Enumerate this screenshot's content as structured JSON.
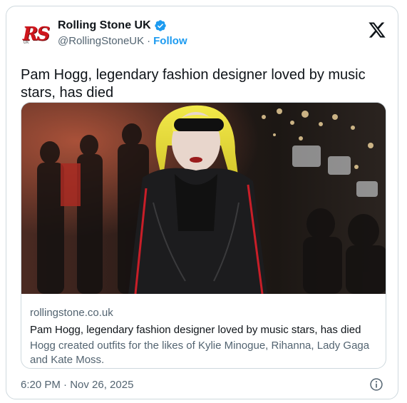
{
  "account": {
    "logo_text": "RS",
    "logo_sub": "UK",
    "display_name": "Rolling Stone UK",
    "handle": "@RollingStoneUK",
    "separator": "·",
    "follow_label": "Follow"
  },
  "tweet": {
    "text": "Pam Hogg, legendary fashion designer loved by music stars, has died"
  },
  "link_card": {
    "domain": "rollingstone.co.uk",
    "title": "Pam Hogg, legendary fashion designer loved by music stars, has died",
    "description": "Hogg created outfits for the likes of Kylie Minogue, Rihanna, Lady Gaga and Kate Moss."
  },
  "footer": {
    "timestamp": "6:20 PM · Nov 26, 2025"
  },
  "icons": {
    "verified": "verified-badge-icon",
    "x_logo": "x-logo-icon",
    "info": "info-icon"
  },
  "colors": {
    "accent": "#1d9bf0",
    "text_primary": "#0f1419",
    "text_secondary": "#536471",
    "border": "#cfd9de",
    "brand_red": "#d0161d"
  }
}
